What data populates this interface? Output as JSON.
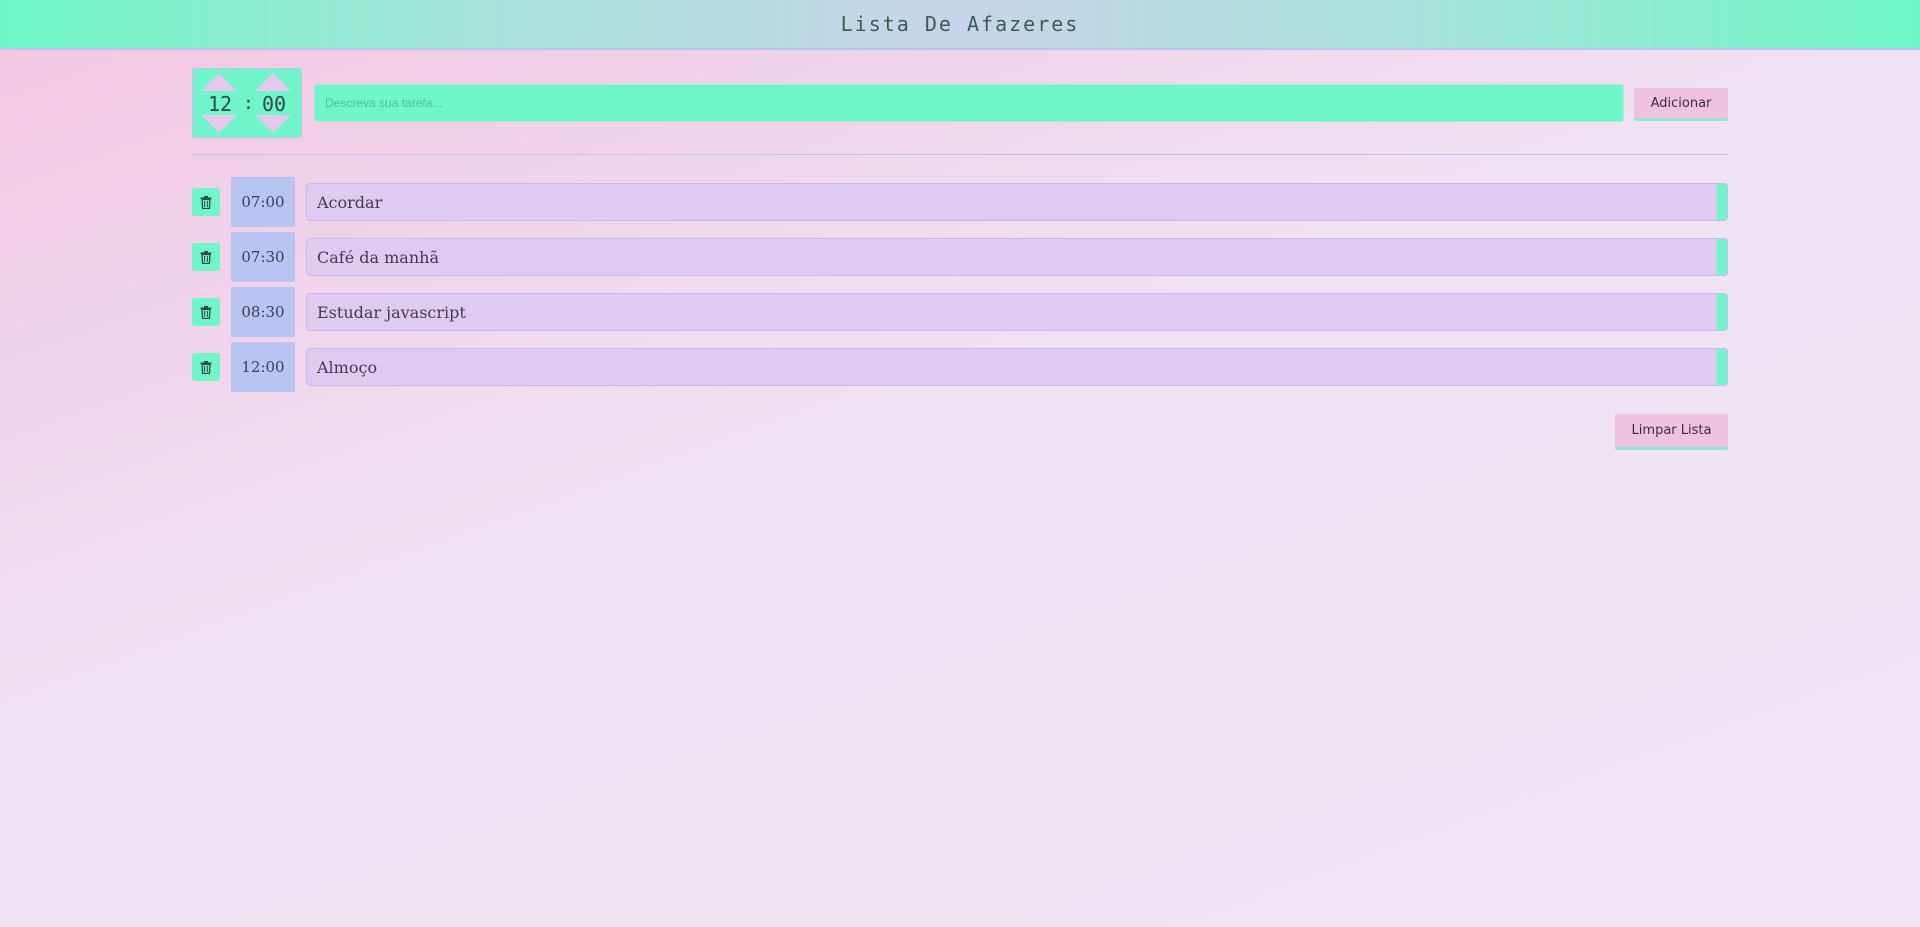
{
  "header": {
    "title": "Lista De Afazeres"
  },
  "time_picker": {
    "hours": "12",
    "separator": ":",
    "minutes": "00"
  },
  "task_input": {
    "value": "",
    "placeholder": "Descreva sua tarefa..."
  },
  "add_button": {
    "label": "Adicionar"
  },
  "tasks": [
    {
      "time": "07:00",
      "text": "Acordar"
    },
    {
      "time": "07:30",
      "text": "Café da manhã"
    },
    {
      "time": "08:30",
      "text": "Estudar javascript"
    },
    {
      "time": "12:00",
      "text": "Almoço"
    }
  ],
  "clear_button": {
    "label": "Limpar Lista"
  },
  "colors": {
    "accent_green": "#6ff5c9",
    "pink": "#efc2df",
    "lavender": "#dfcbf1",
    "periwinkle": "#b8c4f2"
  },
  "icons": {
    "delete": "trash-icon",
    "increment": "triangle-up-icon",
    "decrement": "triangle-down-icon"
  }
}
